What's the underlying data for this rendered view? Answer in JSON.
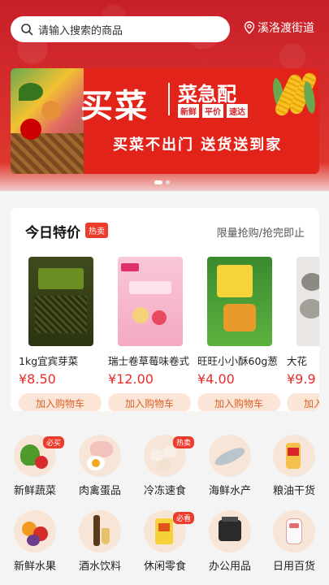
{
  "header": {
    "search_placeholder": "请输入搜索的商品",
    "location": "溪洛渡街道"
  },
  "banner": {
    "title_main": "买菜",
    "title_sub": "菜急配",
    "tags": [
      "新鲜",
      "平价",
      "速达"
    ],
    "slogan": "买菜不出门 送货送到家"
  },
  "deals": {
    "title": "今日特价",
    "badge": "热卖",
    "hint": "限量抢购/抢完即止",
    "cart_label": "加入购物车",
    "products": [
      {
        "name": "1kg宜宾芽菜",
        "price": "¥8.50"
      },
      {
        "name": "瑞士卷草莓味卷式",
        "price": "¥12.00"
      },
      {
        "name": "旺旺小小酥60g葱",
        "price": "¥4.00"
      },
      {
        "name": "大花",
        "price": "¥9.9"
      }
    ]
  },
  "categories": [
    {
      "label": "新鲜蔬菜",
      "badge": "必买",
      "icon": "vegetables-icon"
    },
    {
      "label": "肉禽蛋品",
      "badge": "",
      "icon": "meat-egg-icon"
    },
    {
      "label": "冷冻速食",
      "badge": "热卖",
      "icon": "frozen-food-icon"
    },
    {
      "label": "海鲜水产",
      "badge": "",
      "icon": "seafood-icon"
    },
    {
      "label": "粮油干货",
      "badge": "",
      "icon": "grain-oil-icon"
    },
    {
      "label": "新鲜水果",
      "badge": "",
      "icon": "fruit-icon"
    },
    {
      "label": "酒水饮料",
      "badge": "",
      "icon": "drinks-icon"
    },
    {
      "label": "休闲零食",
      "badge": "必看",
      "icon": "snacks-icon"
    },
    {
      "label": "办公用品",
      "badge": "",
      "icon": "office-icon"
    },
    {
      "label": "日用百货",
      "badge": "",
      "icon": "daily-goods-icon"
    }
  ]
}
